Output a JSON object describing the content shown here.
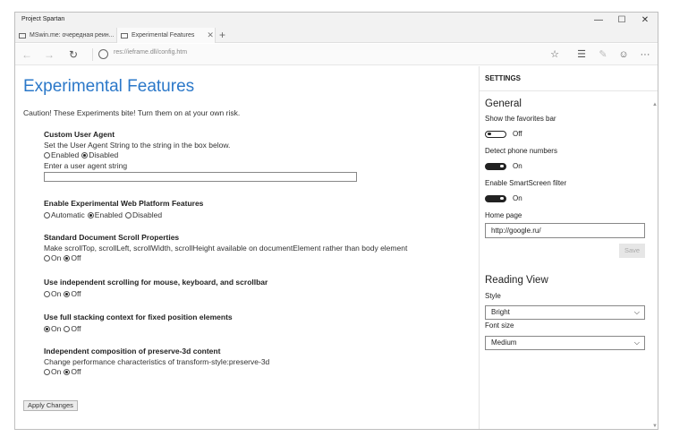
{
  "window": {
    "title": "Project Spartan"
  },
  "window_controls": {
    "minimize": "—",
    "maximize": "☐",
    "close": "✕"
  },
  "tabs": [
    {
      "label": "MSwin.me: очередная реин..."
    },
    {
      "label": "Experimental Features",
      "close": "✕"
    }
  ],
  "new_tab": "+",
  "nav": {
    "back": "←",
    "forward": "→",
    "refresh": "↻",
    "address": "res://ieframe.dll/config.htm"
  },
  "toolbar": {
    "favorite": "☆",
    "hub": "☰",
    "note": "✎",
    "feedback": "☺",
    "more": "···"
  },
  "page": {
    "title": "Experimental Features",
    "caution": "Caution! These Experiments bite! Turn them on at your own risk.",
    "sections": [
      {
        "title": "Custom User Agent",
        "desc": "Set the User Agent String to the string in the box below.",
        "options": [
          {
            "label": "Enabled",
            "checked": false
          },
          {
            "label": "Disabled",
            "checked": true
          }
        ],
        "input_label": "Enter a user agent string",
        "input_value": ""
      },
      {
        "title": "Enable Experimental Web Platform Features",
        "options": [
          {
            "label": "Automatic",
            "checked": false
          },
          {
            "label": "Enabled",
            "checked": true
          },
          {
            "label": "Disabled",
            "checked": false
          }
        ]
      },
      {
        "title": "Standard Document Scroll Properties",
        "desc": "Make scrollTop, scrollLeft, scrollWidth, scrollHeight available on documentElement rather than body element",
        "options": [
          {
            "label": "On",
            "checked": false
          },
          {
            "label": "Off",
            "checked": true
          }
        ]
      },
      {
        "title": "Use independent scrolling for mouse, keyboard, and scrollbar",
        "options": [
          {
            "label": "On",
            "checked": false
          },
          {
            "label": "Off",
            "checked": true
          }
        ]
      },
      {
        "title": "Use full stacking context for fixed position elements",
        "options": [
          {
            "label": "On",
            "checked": true
          },
          {
            "label": "Off",
            "checked": false
          }
        ]
      },
      {
        "title": "Independent composition of preserve-3d content",
        "desc": "Change performance characteristics of transform-style:preserve-3d",
        "options": [
          {
            "label": "On",
            "checked": false
          },
          {
            "label": "Off",
            "checked": true
          }
        ]
      }
    ],
    "apply_button": "Apply Changes"
  },
  "settings": {
    "header": "SETTINGS",
    "general": {
      "heading": "General",
      "favorites_bar": {
        "label": "Show the favorites bar",
        "state": "Off",
        "on": false
      },
      "phone_numbers": {
        "label": "Detect phone numbers",
        "state": "On",
        "on": true
      },
      "smartscreen": {
        "label": "Enable SmartScreen filter",
        "state": "On",
        "on": true
      },
      "home_page": {
        "label": "Home page",
        "value": "http://google.ru/"
      },
      "save_button": "Save"
    },
    "reading_view": {
      "heading": "Reading View",
      "style_label": "Style",
      "style_value": "Bright",
      "font_size_label": "Font size",
      "font_size_value": "Medium"
    },
    "scroll_up": "▲",
    "scroll_down": "▼"
  }
}
